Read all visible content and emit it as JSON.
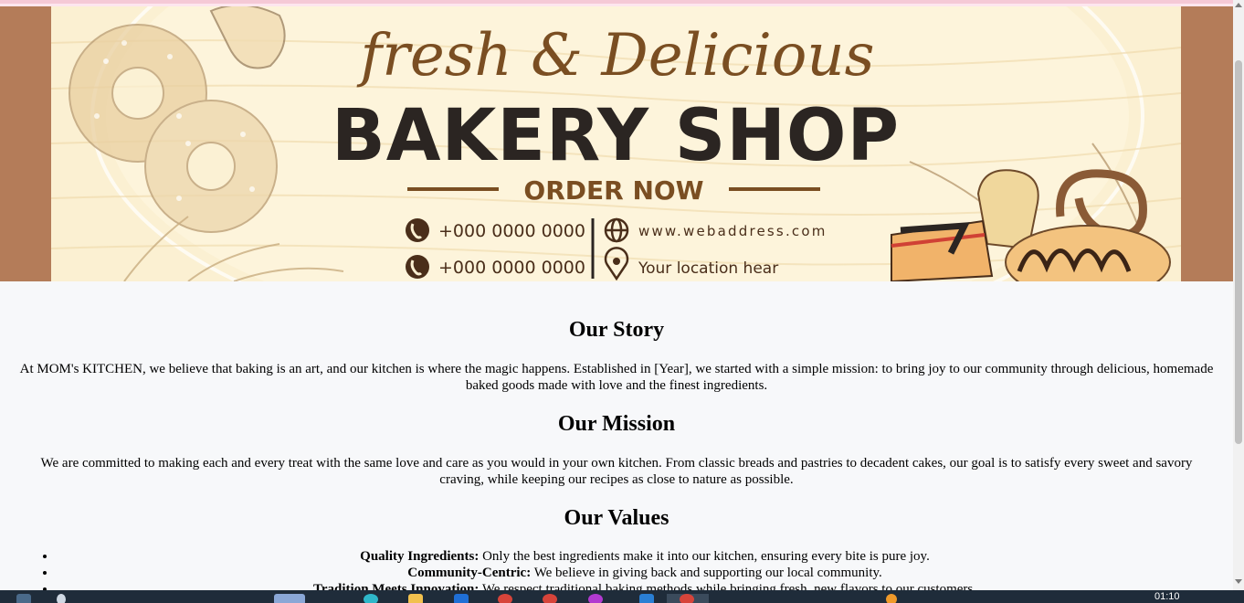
{
  "banner": {
    "script_title": "fresh & Delicious",
    "main_title": "BAKERY SHOP",
    "cta": "ORDER NOW",
    "phone_1": "+000 0000 0000",
    "phone_2": "+000 0000 0000",
    "website": "www.webaddress.com",
    "location": "Your location hear"
  },
  "story": {
    "heading": "Our Story",
    "text": "At MOM's KITCHEN, we believe that baking is an art, and our kitchen is where the magic happens. Established in [Year], we started with a simple mission: to bring joy to our community through delicious, homemade baked goods made with love and the finest ingredients."
  },
  "mission": {
    "heading": "Our Mission",
    "text": "We are committed to making each and every treat with the same love and care as you would in your own kitchen. From classic breads and pastries to decadent cakes, our goal is to satisfy every sweet and savory craving, while keeping our recipes as close to nature as possible."
  },
  "values": {
    "heading": "Our Values",
    "items": [
      {
        "label": "Quality Ingredients:",
        "text": " Only the best ingredients make it into our kitchen, ensuring every bite is pure joy."
      },
      {
        "label": "Community-Centric:",
        "text": " We believe in giving back and supporting our local community."
      },
      {
        "label": "Tradition Meets Innovation:",
        "text": " We respect traditional baking methods while bringing fresh, new flavors to our customers."
      }
    ]
  },
  "taskbar": {
    "time": "01:10"
  },
  "colors": {
    "banner_side": "#b47c59",
    "banner_bg": "#fbf0d2",
    "title_dark": "#2b2522",
    "accent_brown": "#7a4e22"
  }
}
